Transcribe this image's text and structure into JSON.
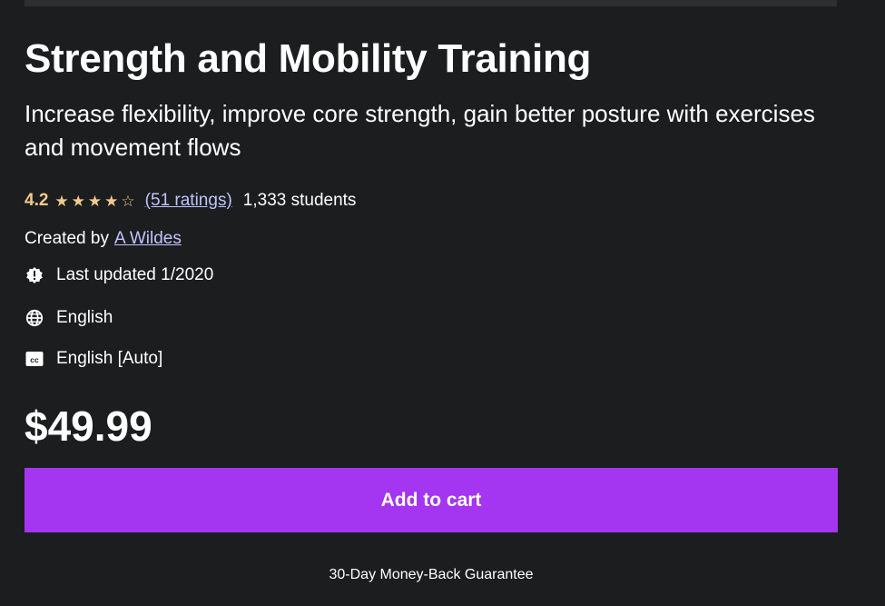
{
  "course": {
    "title": "Strength and Mobility Training",
    "subtitle": "Increase flexibility, improve core strength, gain better posture with exercises and movement flows",
    "rating": {
      "value": "4.2",
      "stars": 4.2,
      "ratings_link": "(51 ratings)",
      "students": "1,333 students"
    },
    "created": {
      "prefix": "Created by",
      "author": "A Wildes"
    },
    "meta": {
      "last_updated": "Last updated 1/2020",
      "language": "English",
      "captions": "English [Auto]"
    },
    "icons": {
      "last_updated": "alert-badge-icon",
      "language": "globe-icon",
      "captions": "closed-captions-icon"
    }
  },
  "purchase": {
    "price": "$49.99",
    "add_to_cart_label": "Add to cart",
    "guarantee": "30-Day Money-Back Guarantee"
  },
  "colors": {
    "background": "#1c1d1f",
    "accent_purple": "#a435f0",
    "star_gold": "#f3ca8c",
    "link": "#c0c4fc"
  }
}
